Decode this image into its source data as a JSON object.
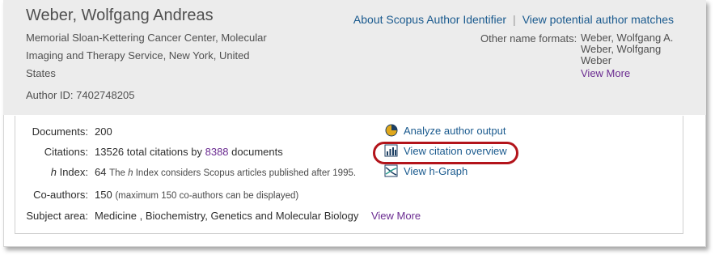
{
  "author": {
    "name": "Weber, Wolfgang Andreas",
    "affiliation_lines": [
      "Memorial Sloan-Kettering Cancer Center, Molecular",
      "Imaging and Therapy Service, New York, United",
      "States"
    ],
    "author_id": "Author ID: 7402748205"
  },
  "top_links": {
    "about": "About Scopus Author Identifier",
    "separator": "|",
    "potential": "View potential author matches"
  },
  "other_names": {
    "label": "Other name formats:",
    "formats": [
      "Weber, Wolfgang A.",
      "Weber, Wolfgang",
      "Weber"
    ],
    "view_more": "View More"
  },
  "metrics": {
    "documents_label": "Documents:",
    "documents_value": "200",
    "citations_label": "Citations:",
    "citations_text": "13526 total citations by",
    "citations_docs_count": "8388",
    "citations_docs_word": "documents",
    "hindex_label_h": "h",
    "hindex_label_rest": " Index:",
    "hindex_value": "64",
    "hindex_note_1": "The",
    "hindex_note_h": "h",
    "hindex_note_2": "Index considers Scopus articles published after 1995.",
    "coauthors_label": "Co-authors:",
    "coauthors_value": "150",
    "coauthors_note": "(maximum 150 co-authors can be displayed)",
    "subject_label": "Subject area:",
    "subject_value": "Medicine ,  Biochemistry, Genetics and Molecular Biology",
    "subject_more": "View More"
  },
  "side_links": {
    "analyze": "Analyze author output",
    "citation_overview": "View citation overview",
    "hgraph": "View h-Graph"
  },
  "colors": {
    "link": "#1a5a8e",
    "visited_link": "#6b2c91",
    "highlight": "#b3141b",
    "header_bg": "#ececec"
  }
}
